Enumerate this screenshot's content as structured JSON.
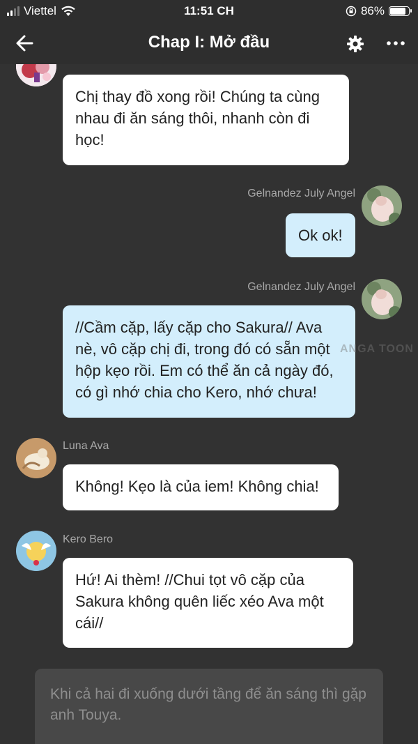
{
  "status_bar": {
    "carrier": "Viettel",
    "time": "11:51 CH",
    "battery": "86%",
    "battery_level": 0.86
  },
  "nav": {
    "title": "Chap I: Mở đầu",
    "back_icon": "arrow-left-icon",
    "settings_icon": "gear-icon",
    "more_icon": "more-horizontal-icon"
  },
  "messages": [
    {
      "sender": "",
      "side": "left",
      "text": "Chị thay đồ xong rồi! Chúng ta cùng nhau đi ăn sáng thôi, nhanh còn đi học!"
    },
    {
      "sender": "Gelnandez July Angel",
      "side": "right",
      "text": "Ok ok!"
    },
    {
      "sender": "Gelnandez July Angel",
      "side": "right",
      "text": "//Cầm cặp, lấy cặp cho Sakura// Ava nè, vô cặp chị đi, trong đó có sẵn một hộp kẹo rồi. Em có thể ăn cả ngày đó, có gì nhớ chia cho Kero, nhớ chưa!"
    },
    {
      "sender": "Luna Ava",
      "side": "left",
      "text": "Không! Kẹo là của iem! Không chia!"
    },
    {
      "sender": "Kero Bero",
      "side": "left",
      "text": "Hứ! Ai thèm! //Chui tọt vô cặp của Sakura không quên liếc xéo Ava một cái//"
    }
  ],
  "narration": "Khi cả hai đi xuống dưới tầng để ăn sáng thì gặp anh Touya.",
  "watermark": "ANGA TOON",
  "colors": {
    "background": "#323232",
    "bubble_other": "#ffffff",
    "bubble_self": "#d3eefc",
    "narration_bg": "#484848"
  }
}
